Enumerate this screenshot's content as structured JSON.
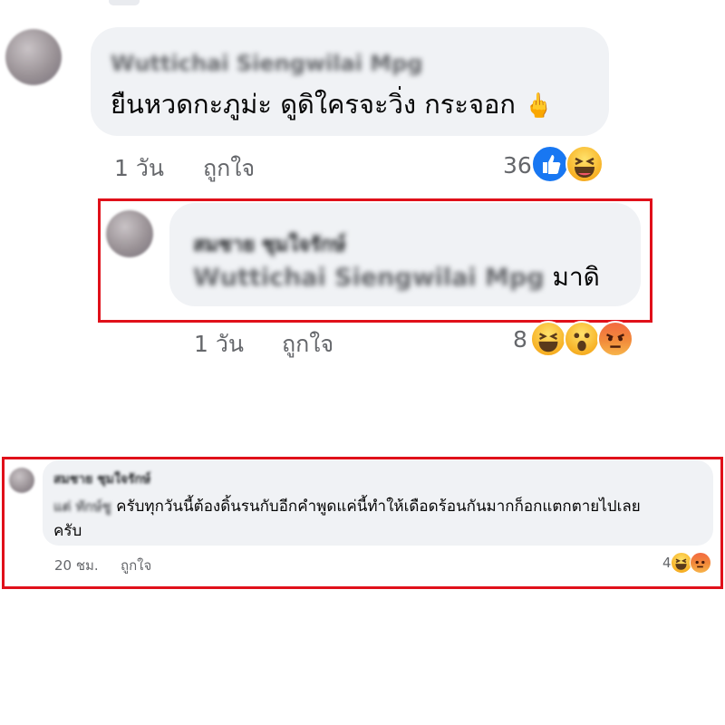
{
  "comment1": {
    "author": "Wuttichai Siengwilai Mpg",
    "text": "ยืนหวดกะภูม่ะ ดูดิใครจะวิ่ง กระจอก",
    "emoji": "🖕",
    "time": "1 วัน",
    "like": "ถูกใจ",
    "reaction_count": "36",
    "reactions": [
      "like-icon",
      "haha-icon"
    ]
  },
  "reply1": {
    "author": "สมชาย ชุมใจรักษ์",
    "mention": "Wuttichai Siengwilai Mpg",
    "text": "มาดิ",
    "time": "1 วัน",
    "like": "ถูกใจ",
    "reaction_count": "8",
    "reactions": [
      "haha-icon",
      "wow-icon",
      "angry-icon"
    ]
  },
  "comment2": {
    "author": "สมชาย ชุมใจรักษ์",
    "mention": "แต่ ทักษ์ชู",
    "text": "ครับทุกวันนี้ต้องดิ้นรนกับอีกคำพูดแค่นี้ทำให้เดือดร้อนกันมากก็อกแตกตายไปเลย",
    "text2": "ครับ",
    "time": "20 ชม.",
    "like": "ถูกใจ",
    "reaction_count": "4",
    "reactions": [
      "haha-icon",
      "angry-icon"
    ]
  },
  "colors": {
    "highlight_border": "#e0101a",
    "bubble": "#f0f2f5",
    "meta_text": "#65676b",
    "like_blue": "#1877f2"
  }
}
